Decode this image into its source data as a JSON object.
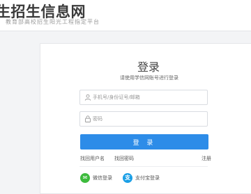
{
  "header": {
    "title": "生招生信息网",
    "subtitle": "教育部高校招生阳光工程指定平台"
  },
  "login": {
    "title": "登录",
    "hint": "请使用学信网账号进行登录",
    "username_placeholder": "手机号/身份证号/邮箱",
    "password_placeholder": "密码",
    "submit_label": "登 录",
    "forgot_username": "找回用户名",
    "forgot_password": "找回密码",
    "register": "注册",
    "wechat_label": "微信登录",
    "alipay_label": "支付宝登录"
  },
  "colors": {
    "primary": "#2d8ce8",
    "wechat": "#3dbb3d",
    "alipay": "#1a9fe6"
  }
}
